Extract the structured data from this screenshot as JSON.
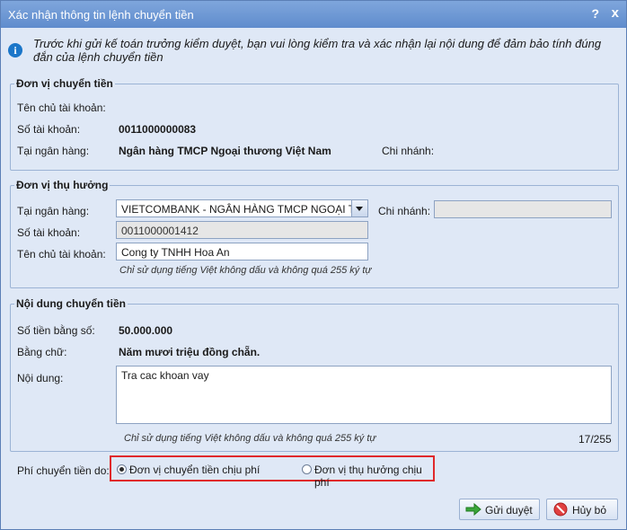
{
  "dialog": {
    "title": "Xác nhận thông tin lệnh chuyển tiền",
    "help_glyph": "?",
    "close_glyph": "x",
    "notice": "Trước khi gửi kế toán trưởng kiểm duyệt, bạn vui lòng kiểm tra và xác nhận lại nội dung để đảm bảo tính đúng đắn của lệnh chuyển tiền"
  },
  "sender": {
    "legend": "Đơn vị chuyển tiền",
    "account_holder_label": "Tên chủ tài khoản:",
    "account_holder_value": "",
    "account_number_label": "Số tài khoản:",
    "account_number_value": "0011000000083",
    "bank_label": "Tại ngân hàng:",
    "bank_value": "Ngân hàng TMCP Ngoại thương Việt Nam",
    "branch_label": "Chi nhánh:",
    "branch_value": ""
  },
  "beneficiary": {
    "legend": "Đơn vị thụ hưởng",
    "bank_label": "Tại ngân hàng:",
    "bank_value": "VIETCOMBANK - NGÂN HÀNG TMCP NGOẠI T",
    "branch_label": "Chi nhánh:",
    "branch_value": "",
    "account_number_label": "Số tài khoản:",
    "account_number_value": "0011000001412",
    "account_holder_label": "Tên chủ tài khoản:",
    "account_holder_value": "Cong ty TNHH Hoa An",
    "hint": "Chỉ sử dụng tiếng Việt không dấu và không quá 255 ký tự"
  },
  "transfer": {
    "legend": "Nội dung chuyển tiền",
    "amount_label": "Số tiền bằng số:",
    "amount_value": "50.000.000",
    "amount_words_label": "Bằng chữ:",
    "amount_words_value": "Năm mươi triệu đồng chẵn.",
    "content_label": "Nội dung:",
    "content_value": "Tra cac khoan vay",
    "hint": "Chỉ sử dụng tiếng Việt không dấu và không quá 255 ký tự",
    "char_count": "17/255"
  },
  "fee": {
    "label": "Phí chuyển tiền do:",
    "options": [
      "Đơn vị chuyển tiền chịu phí",
      "Đơn vị thụ hưởng chịu phí"
    ],
    "selected": "Đơn vị chuyển tiền chịu phí"
  },
  "buttons": {
    "submit": "Gửi duyệt",
    "cancel": "Hủy bỏ"
  },
  "icons": {
    "info": "info-icon",
    "submit": "green-arrow-icon",
    "cancel": "red-cancel-icon",
    "dropdown": "chevron-down-icon"
  },
  "colors": {
    "titlebar": "#6b96d3",
    "background": "#dfe8f6",
    "highlight_border": "#e0292b"
  }
}
